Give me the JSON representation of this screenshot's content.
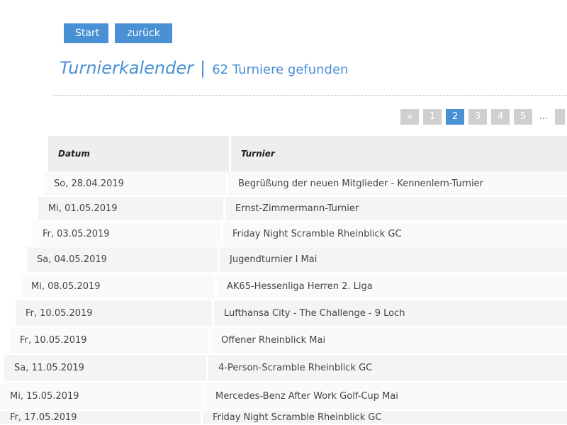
{
  "nav": {
    "start_label": "Start",
    "back_label": "zurück"
  },
  "header": {
    "title": "Turnierkalender",
    "separator": "|",
    "count": "62 Turniere gefunden"
  },
  "pagination": {
    "prev": "«",
    "pages": [
      "1",
      "2",
      "3",
      "4",
      "5"
    ],
    "active": "2",
    "ellipsis": "..."
  },
  "table": {
    "columns": [
      "Datum",
      "Turnier"
    ],
    "rows": [
      {
        "date": "So, 28.04.2019",
        "name": "Begrüßung der neuen Mitglieder - Kennenlern-Turnier"
      },
      {
        "date": "Mi, 01.05.2019",
        "name": "Ernst-Zimmermann-Turnier"
      },
      {
        "date": "Fr, 03.05.2019",
        "name": "Friday Night Scramble Rheinblick GC"
      },
      {
        "date": "Sa, 04.05.2019",
        "name": "Jugendturnier I Mai"
      },
      {
        "date": "Mi, 08.05.2019",
        "name": "AK65-Hessenliga Herren 2. Liga"
      },
      {
        "date": "Fr, 10.05.2019",
        "name": "Lufthansa City - The Challenge - 9 Loch"
      },
      {
        "date": "Fr, 10.05.2019",
        "name": "Offener Rheinblick Mai"
      },
      {
        "date": "Sa, 11.05.2019",
        "name": "4-Person-Scramble Rheinblick GC"
      },
      {
        "date": "Mi, 15.05.2019",
        "name": "Mercedes-Benz After Work Golf-Cup Mai"
      },
      {
        "date": "Fr, 17.05.2019",
        "name": "Friday Night Scramble Rheinblick GC"
      }
    ]
  }
}
